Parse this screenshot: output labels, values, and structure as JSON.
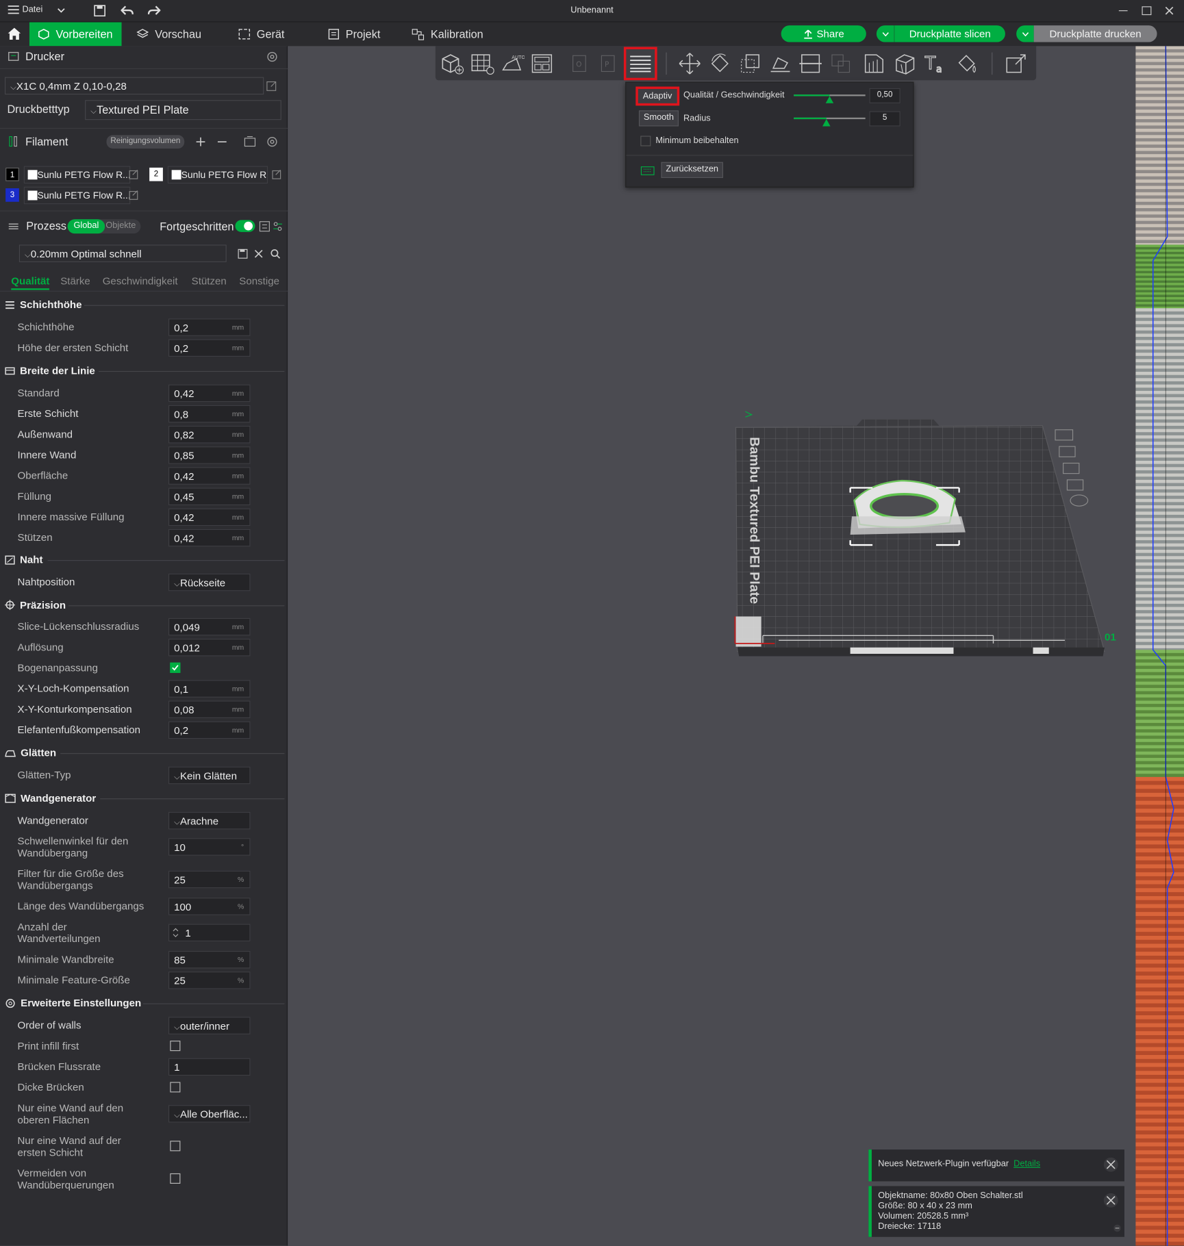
{
  "window": {
    "title": "Unbenannt",
    "menu_label": "Datei"
  },
  "tabs": [
    {
      "label": "Vorbereiten"
    },
    {
      "label": "Vorschau"
    },
    {
      "label": "Gerät"
    },
    {
      "label": "Projekt"
    },
    {
      "label": "Kalibration"
    }
  ],
  "actions": {
    "share": "Share",
    "slice": "Druckplatte slicen",
    "print": "Druckplatte drucken"
  },
  "printer": {
    "section_label": "Drucker",
    "preset": "X1C 0,4mm Z 0,10-0,28",
    "bed_label": "Druckbetttyp",
    "bed_value": "Textured PEI Plate"
  },
  "filament": {
    "section_label": "Filament",
    "purge_label": "Reinigungsvolumen",
    "items": [
      {
        "num": "1",
        "name": "Sunlu PETG Flow R...",
        "num_color": "#000000"
      },
      {
        "num": "2",
        "name": "Sunlu PETG Flow R...",
        "num_color": "#ffffff"
      },
      {
        "num": "3",
        "name": "Sunlu PETG Flow R...",
        "num_color": "#1a2cc9"
      }
    ]
  },
  "process": {
    "section_label": "Prozess",
    "global_label": "Global",
    "objects_label": "Objekte",
    "advanced_label": "Fortgeschritten",
    "preset": "0.20mm Optimal schnell",
    "subtabs": [
      "Qualität",
      "Stärke",
      "Geschwindigkeit",
      "Stützen",
      "Sonstige"
    ]
  },
  "groups": {
    "layer_height": "Schichthöhe",
    "line_width": "Breite der Linie",
    "seam": "Naht",
    "precision": "Präzision",
    "ironing": "Glätten",
    "wall_generator": "Wandgenerator",
    "advanced": "Erweiterte Einstellungen"
  },
  "settings": {
    "layer_height": {
      "label": "Schichthöhe",
      "value": "0,2",
      "unit": "mm"
    },
    "first_layer_height": {
      "label": "Höhe der ersten Schicht",
      "value": "0,2",
      "unit": "mm"
    },
    "lw_default": {
      "label": "Standard",
      "value": "0,42",
      "unit": "mm"
    },
    "lw_first": {
      "label": "Erste Schicht",
      "value": "0,8",
      "unit": "mm"
    },
    "lw_outer": {
      "label": "Außenwand",
      "value": "0,82",
      "unit": "mm"
    },
    "lw_inner": {
      "label": "Innere Wand",
      "value": "0,85",
      "unit": "mm"
    },
    "lw_top": {
      "label": "Oberfläche",
      "value": "0,42",
      "unit": "mm"
    },
    "lw_infill": {
      "label": "Füllung",
      "value": "0,45",
      "unit": "mm"
    },
    "lw_solid": {
      "label": "Innere massive Füllung",
      "value": "0,42",
      "unit": "mm"
    },
    "lw_support": {
      "label": "Stützen",
      "value": "0,42",
      "unit": "mm"
    },
    "seam_pos": {
      "label": "Nahtposition",
      "value": "Rückseite"
    },
    "gap_close": {
      "label": "Slice-Lückenschlussradius",
      "value": "0,049",
      "unit": "mm"
    },
    "resolution": {
      "label": "Auflösung",
      "value": "0,012",
      "unit": "mm"
    },
    "arc_fit": {
      "label": "Bogenanpassung"
    },
    "xy_hole": {
      "label": "X-Y-Loch-Kompensation",
      "value": "0,1",
      "unit": "mm"
    },
    "xy_contour": {
      "label": "X-Y-Konturkompensation",
      "value": "0,08",
      "unit": "mm"
    },
    "elephant": {
      "label": "Elefantenfußkompensation",
      "value": "0,2",
      "unit": "mm"
    },
    "ironing_type": {
      "label": "Glätten-Typ",
      "value": "Kein Glätten"
    },
    "wall_gen": {
      "label": "Wandgenerator",
      "value": "Arachne"
    },
    "trans_angle": {
      "label": "Schwellenwinkel für den Wandübergang",
      "value": "10",
      "unit": "°"
    },
    "trans_filter": {
      "label": "Filter für die Größe des Wandübergangs",
      "value": "25",
      "unit": "%"
    },
    "trans_length": {
      "label": "Länge des Wandübergangs",
      "value": "100",
      "unit": "%"
    },
    "wall_dist": {
      "label": "Anzahl der Wandverteilungen",
      "value": "1"
    },
    "min_wall": {
      "label": "Minimale Wandbreite",
      "value": "85",
      "unit": "%"
    },
    "min_feature": {
      "label": "Minimale Feature-Größe",
      "value": "25",
      "unit": "%"
    },
    "wall_order": {
      "label": "Order of walls",
      "value": "outer/inner"
    },
    "infill_first": {
      "label": "Print infill first"
    },
    "bridge_flow": {
      "label": "Brücken Flussrate",
      "value": "1"
    },
    "thick_bridges": {
      "label": "Dicke Brücken"
    },
    "one_wall_top": {
      "label": "Nur eine Wand auf den oberen Flächen",
      "value": "Alle Oberfläc..."
    },
    "one_wall_first": {
      "label": "Nur eine Wand auf der ersten Schicht"
    },
    "avoid_crossing": {
      "label": "Vermeiden von Wandüberquerungen"
    }
  },
  "popup": {
    "adaptive_label": "Adaptiv",
    "quality_label": "Qualität / Geschwindigkeit",
    "quality_value": "0,50",
    "quality_fraction": 0.5,
    "smooth_label": "Smooth",
    "radius_label": "Radius",
    "radius_value": "5",
    "radius_fraction": 0.45,
    "keep_min_label": "Minimum beibehalten",
    "reset_label": "Zurücksetzen"
  },
  "plate": {
    "bed_text": "Bambu Textured PEI Plate",
    "plate_number": "01"
  },
  "notifications": {
    "plugin_text": "Neues Netzwerk-Plugin verfügbar",
    "plugin_link": "Details",
    "object_name": "Objektname: 80x80 Oben Schalter.stl",
    "object_size": "Größe: 80 x 40 x 23 mm",
    "object_volume": "Volumen: 20528.5 mm³",
    "object_triangles": "Dreiecke: 17118"
  },
  "colors": {
    "accent": "#00ae42",
    "highlight": "#e0141c",
    "layer_line": "#1f3cff"
  }
}
